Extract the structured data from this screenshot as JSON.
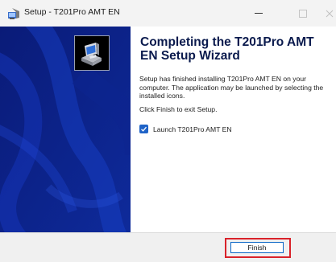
{
  "window": {
    "title": "Setup - T201Pro AMT EN"
  },
  "content": {
    "heading": "Completing the T201Pro AMT EN Setup Wizard",
    "description": "Setup has finished installing T201Pro AMT EN on your computer. The application may be launched by selecting the installed icons.",
    "exit_note": "Click Finish to exit Setup.",
    "launch_checkbox": {
      "label": "Launch T201Pro AMT EN",
      "checked": true
    }
  },
  "footer": {
    "finish_label": "Finish"
  },
  "colors": {
    "banner": "#0b1e7c",
    "heading": "#0a1a4d",
    "accent": "#1f63c7",
    "highlight": "#d9222a"
  },
  "icons": [
    "setup-app-icon",
    "minimize-icon",
    "maximize-icon",
    "close-icon",
    "computer-install-icon",
    "checkmark-icon"
  ]
}
